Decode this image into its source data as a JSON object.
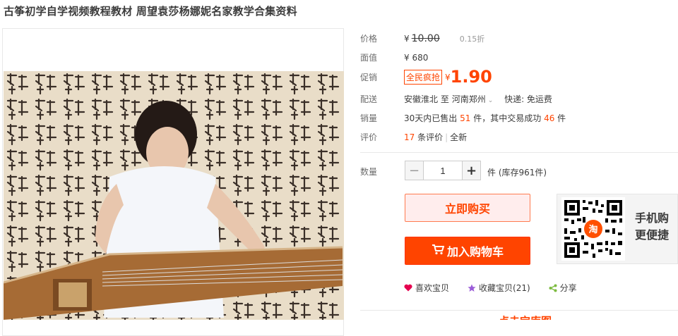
{
  "title": "古筝初学自学视频教程教材 周望袁莎杨娜妮名家教学合集资料",
  "meta": {
    "price_label": "价格",
    "price_symbol": "¥",
    "original_price": "10.00",
    "discount": "0.15折",
    "face_label": "面值",
    "face_value": "¥ 680",
    "promo_label": "促销",
    "promo_badge": "全民疯抢",
    "promo_symbol": "¥",
    "promo_price": "1.90",
    "ship_label": "配送",
    "ship_from": "安徽淮北",
    "ship_to_word": "至",
    "ship_to": "河南郑州",
    "ship_fee": "快递: 免运费",
    "sales_label": "销量",
    "sales_prefix": "30天内已售出",
    "sales_count": "51",
    "sales_mid": "件，其中交易成功",
    "sales_success": "46",
    "sales_suffix": "件",
    "review_label": "评价",
    "review_count": "17",
    "review_text": "条评价",
    "review_tag": "全新"
  },
  "purchase": {
    "qty_label": "数量",
    "minus": "−",
    "qty_value": "1",
    "plus": "+",
    "unit": "件",
    "stock": "(库存961件)",
    "buy_label": "立即购买",
    "cart_label": "加入购物车",
    "qr_text_line1": "手机购",
    "qr_text_line2": "更便捷",
    "qr_badge": "淘"
  },
  "actions": {
    "like": "喜欢宝贝",
    "favorite": "收藏宝贝(21)",
    "share": "分享"
  },
  "footer_cut_text": "点击宝库图",
  "colors": {
    "accent": "#ff4400",
    "badge_border": "#ff4400",
    "like_heart": "#e5004f",
    "fav_star": "#9a5bd8",
    "share": "#7cbb3f"
  }
}
